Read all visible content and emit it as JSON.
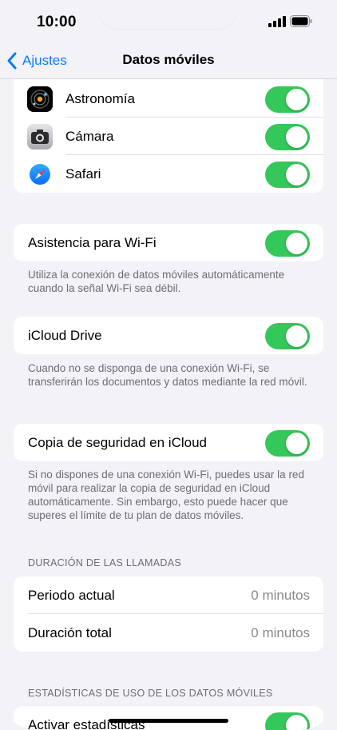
{
  "status_bar": {
    "time": "10:00"
  },
  "nav": {
    "back_label": "Ajustes",
    "title": "Datos móviles"
  },
  "apps": [
    {
      "label": "Astronomía",
      "icon": "astronomy-app-icon",
      "enabled": true
    },
    {
      "label": "Cámara",
      "icon": "camera-app-icon",
      "enabled": true
    },
    {
      "label": "Safari",
      "icon": "safari-app-icon",
      "enabled": true
    }
  ],
  "wifi_assist": {
    "label": "Asistencia para Wi-Fi",
    "enabled": true,
    "footnote": "Utiliza la conexión de datos móviles automáticamente cuando la señal Wi-Fi sea débil."
  },
  "icloud_drive": {
    "label": "iCloud Drive",
    "enabled": true,
    "footnote": "Cuando no se disponga de una conexión Wi-Fi, se transferirán los documentos y datos mediante la red móvil."
  },
  "icloud_backup": {
    "label": "Copia de seguridad en iCloud",
    "enabled": true,
    "footnote": "Si no dispones de una conexión Wi-Fi, puedes usar la red móvil para realizar la copia de seguridad en iCloud automáticamente. Sin embargo, esto puede hacer que superes el límite de tu plan de datos móviles."
  },
  "call_duration": {
    "header": "DURACIÓN DE LAS LLAMADAS",
    "current_label": "Periodo actual",
    "current_value": "0 minutos",
    "total_label": "Duración total",
    "total_value": "0 minutos"
  },
  "usage_stats": {
    "header": "ESTADÍSTICAS DE USO DE LOS DATOS MÓVILES",
    "label": "Activar estadísticas",
    "enabled": true
  },
  "colors": {
    "accent": "#0a7aff",
    "toggle_on": "#34c759",
    "background": "#f2f2f7"
  }
}
